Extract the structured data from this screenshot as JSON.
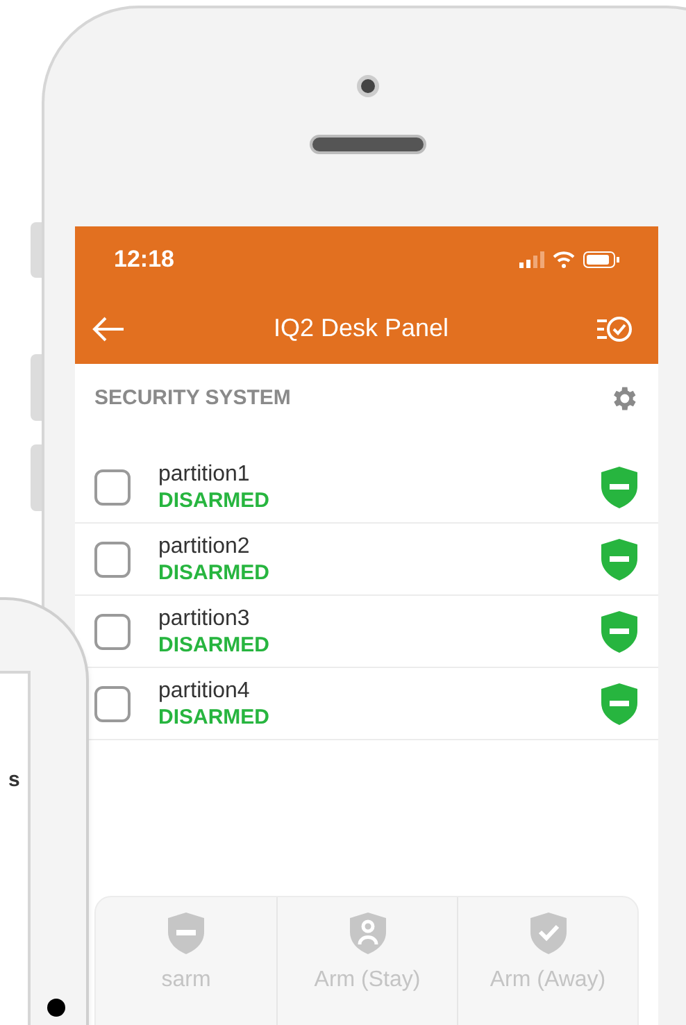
{
  "status_bar": {
    "time": "12:18"
  },
  "header": {
    "title": "IQ2 Desk Panel"
  },
  "section": {
    "title": "SECURITY SYSTEM"
  },
  "partitions": [
    {
      "name": "partition1",
      "status": "DISARMED",
      "checked": false
    },
    {
      "name": "partition2",
      "status": "DISARMED",
      "checked": false
    },
    {
      "name": "partition3",
      "status": "DISARMED",
      "checked": false
    },
    {
      "name": "partition4",
      "status": "DISARMED",
      "checked": false
    }
  ],
  "actions": [
    {
      "label": "sarm",
      "kind": "disarm"
    },
    {
      "label": "Arm (Stay)",
      "kind": "stay"
    },
    {
      "label": "Arm (Away)",
      "kind": "away"
    }
  ],
  "second_device": {
    "fragment": "s"
  }
}
